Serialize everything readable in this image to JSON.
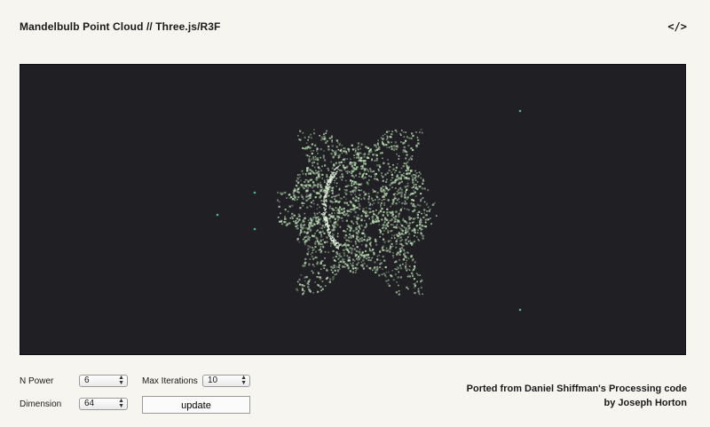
{
  "header": {
    "title": "Mandelbulb Point Cloud // Three.js/R3F",
    "code_link": "</>"
  },
  "viewport": {
    "background": "#201f24",
    "point_color": "#b7d9b0",
    "stray_point_color": "#4fb98a"
  },
  "controls": {
    "n_power": {
      "label": "N Power",
      "value": "6"
    },
    "max_iterations": {
      "label": "Max Iterations",
      "value": "10"
    },
    "dimension": {
      "label": "Dimension",
      "value": "64"
    },
    "update_label": "update"
  },
  "credit": {
    "line1": "Ported from Daniel Shiffman's Processing code",
    "line2": "by Joseph Horton"
  }
}
